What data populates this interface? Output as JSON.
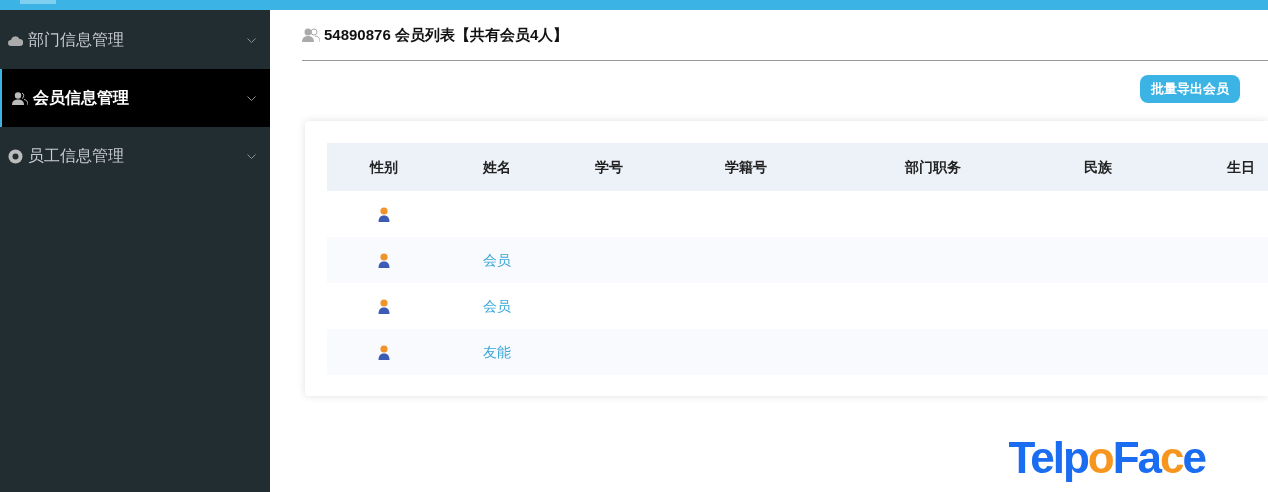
{
  "sidebar": {
    "items": [
      {
        "label": "部门信息管理",
        "selected": false
      },
      {
        "label": "会员信息管理",
        "selected": true
      },
      {
        "label": "员工信息管理",
        "selected": false
      }
    ]
  },
  "page_title": "54890876 会员列表【共有会员4人】",
  "export_button": "批量导出会员",
  "table": {
    "columns": [
      "性别",
      "姓名",
      "学号",
      "学籍号",
      "部门职务",
      "民族",
      "生日"
    ],
    "rows": [
      {
        "kind": "male"
      },
      {
        "kind": "male",
        "name": "会员"
      },
      {
        "kind": "male",
        "name": "会员"
      },
      {
        "kind": "male",
        "name": "友能"
      }
    ]
  },
  "logo": [
    {
      "text": "Telp",
      "accent": false
    },
    {
      "text": "o",
      "accent": true
    },
    {
      "text": "Fa",
      "accent": false
    },
    {
      "text": "c",
      "accent": true
    },
    {
      "text": "e",
      "accent": false
    }
  ]
}
